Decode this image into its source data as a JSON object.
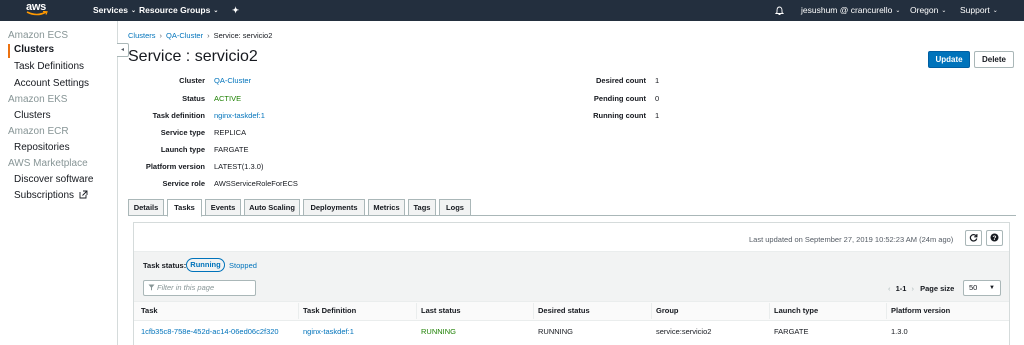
{
  "topnav": {
    "logo_text": "aws",
    "services": "Services",
    "resource_groups": "Resource Groups",
    "user": "jesushum @ crancurello",
    "region": "Oregon",
    "support": "Support"
  },
  "sidebar": {
    "toggle": "◂",
    "sections": [
      {
        "heading": "Amazon ECS",
        "items": [
          "Clusters",
          "Task Definitions",
          "Account Settings"
        ]
      },
      {
        "heading": "Amazon EKS",
        "items": [
          "Clusters"
        ]
      },
      {
        "heading": "Amazon ECR",
        "items": [
          "Repositories"
        ]
      },
      {
        "heading": "AWS Marketplace",
        "items": [
          "Discover software",
          "Subscriptions"
        ]
      }
    ]
  },
  "breadcrumb": [
    "Clusters",
    "QA-Cluster",
    "Service: servicio2"
  ],
  "page_title": "Service : servicio2",
  "buttons": {
    "update": "Update",
    "delete": "Delete"
  },
  "details_left": [
    {
      "label": "Cluster",
      "value": "QA-Cluster"
    },
    {
      "label": "Status",
      "value": "ACTIVE"
    },
    {
      "label": "Task definition",
      "value": "nginx-taskdef:1"
    },
    {
      "label": "Service type",
      "value": "REPLICA"
    },
    {
      "label": "Launch type",
      "value": "FARGATE"
    },
    {
      "label": "Platform version",
      "value": "LATEST(1.3.0)"
    },
    {
      "label": "Service role",
      "value": "AWSServiceRoleForECS"
    }
  ],
  "details_right": [
    {
      "label": "Desired count",
      "value": "1"
    },
    {
      "label": "Pending count",
      "value": "0"
    },
    {
      "label": "Running count",
      "value": "1"
    }
  ],
  "tabs": [
    "Details",
    "Tasks",
    "Events",
    "Auto Scaling",
    "Deployments",
    "Metrics",
    "Tags",
    "Logs"
  ],
  "active_tab": "Tasks",
  "last_updated": "Last updated on September 27, 2019 10:52:23 AM (24m ago)",
  "task_status": {
    "label": "Task status:",
    "running": "Running",
    "stopped": "Stopped"
  },
  "filter_placeholder": "Filter in this page",
  "pagination": {
    "prev": "‹",
    "range": "1-1",
    "next": "›",
    "page_size_label": "Page size",
    "page_size": "50"
  },
  "table": {
    "headers": [
      "Task",
      "Task Definition",
      "Last status",
      "Desired status",
      "Group",
      "Launch type",
      "Platform version"
    ],
    "rows": [
      [
        "1cfb35c8-758e-452d-ac14-06ed06c2f320",
        "nginx-taskdef:1",
        "RUNNING",
        "RUNNING",
        "service:servicio2",
        "FARGATE",
        "1.3.0"
      ]
    ]
  },
  "colors": {
    "nav_bg": "#232f3e",
    "link": "#0073bb",
    "accent": "#ec7211",
    "success": "#1d8102",
    "primary_button": "#0073bb"
  }
}
